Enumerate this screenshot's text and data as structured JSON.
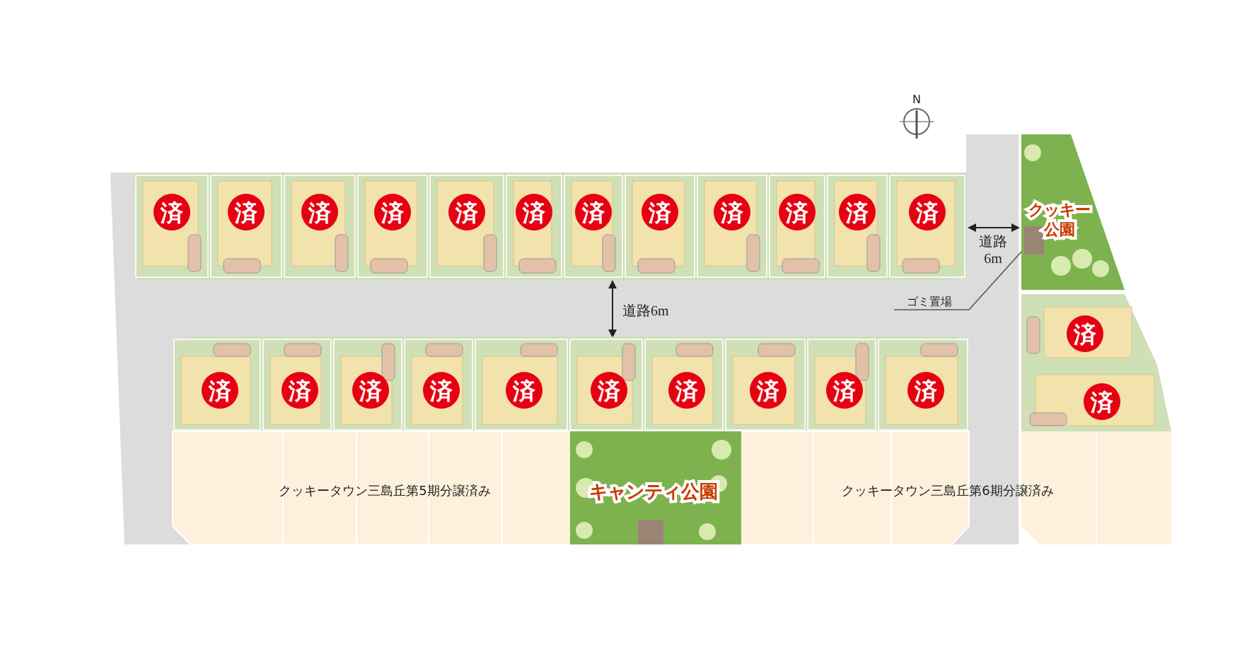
{
  "compass": {
    "label": "N"
  },
  "north_row": {
    "lots": [
      {
        "badge": "済"
      },
      {
        "badge": "済"
      },
      {
        "badge": "済"
      },
      {
        "badge": "済"
      },
      {
        "badge": "済"
      },
      {
        "badge": "済"
      },
      {
        "badge": "済"
      },
      {
        "badge": "済"
      },
      {
        "badge": "済"
      },
      {
        "badge": "済"
      },
      {
        "badge": "済"
      },
      {
        "badge": "済"
      }
    ]
  },
  "road_labels": [
    {
      "kind": "vertical",
      "lines": [
        "道路6m"
      ]
    },
    {
      "kind": "horizontal",
      "lines": [
        "道路",
        "6m"
      ]
    }
  ],
  "garbage_area": {
    "label": "ゴミ置場"
  },
  "parks": [
    {
      "kind": "east",
      "name_lines": [
        "クッキー",
        "公園"
      ]
    },
    {
      "kind": "south",
      "name_lines": [
        "キャンティ公園"
      ]
    }
  ],
  "south_row": {
    "lots": [
      {
        "badge": "済"
      },
      {
        "badge": "済"
      },
      {
        "badge": "済"
      },
      {
        "badge": "済"
      },
      {
        "badge": "済"
      },
      {
        "badge": "済"
      },
      {
        "badge": "済"
      },
      {
        "badge": "済"
      },
      {
        "badge": "済"
      },
      {
        "badge": "済"
      }
    ]
  },
  "east_lots": [
    {
      "badge": "済"
    },
    {
      "badge": "済"
    }
  ],
  "sold_areas": [
    {
      "label": "クッキータウン三島丘第5期分譲済み"
    },
    {
      "label": "クッキータウン三島丘第6期分譲済み"
    }
  ]
}
